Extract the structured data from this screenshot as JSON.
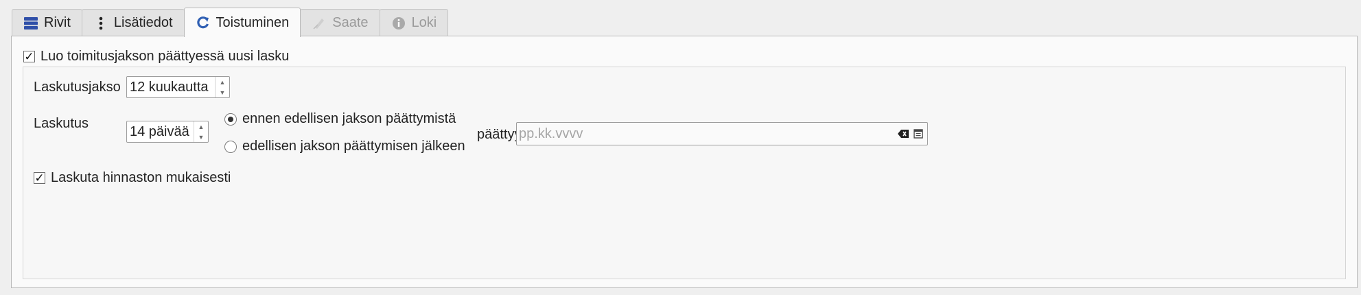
{
  "tabs": [
    {
      "label": "Rivit",
      "icon": "rows-icon",
      "state": "normal"
    },
    {
      "label": "Lisätiedot",
      "icon": "more-vertical-icon",
      "state": "normal"
    },
    {
      "label": "Toistuminen",
      "icon": "refresh-icon",
      "state": "active"
    },
    {
      "label": "Saate",
      "icon": "note-icon",
      "state": "disabled"
    },
    {
      "label": "Loki",
      "icon": "info-icon",
      "state": "disabled"
    }
  ],
  "recurrence": {
    "create_invoice_label": "Luo toimitusjakson päättyessä uusi lasku",
    "create_invoice_checked": true,
    "billing_period_label": "Laskutusjakso",
    "billing_period_value": "12 kuukautta",
    "billing_label": "Laskutus",
    "billing_days_value": "14 päivää",
    "option_before_label": "ennen edellisen jakson päättymistä",
    "option_after_label": "edellisen jakson päättymisen jälkeen",
    "selected_option": "before",
    "ends_label": "päättyy",
    "ends_placeholder": "pp.kk.vvvv",
    "price_list_label": "Laskuta hinnaston mukaisesti",
    "price_list_checked": true
  },
  "colors": {
    "accent_blue": "#2f5fb3",
    "disabled_text": "#9a9a9a"
  }
}
